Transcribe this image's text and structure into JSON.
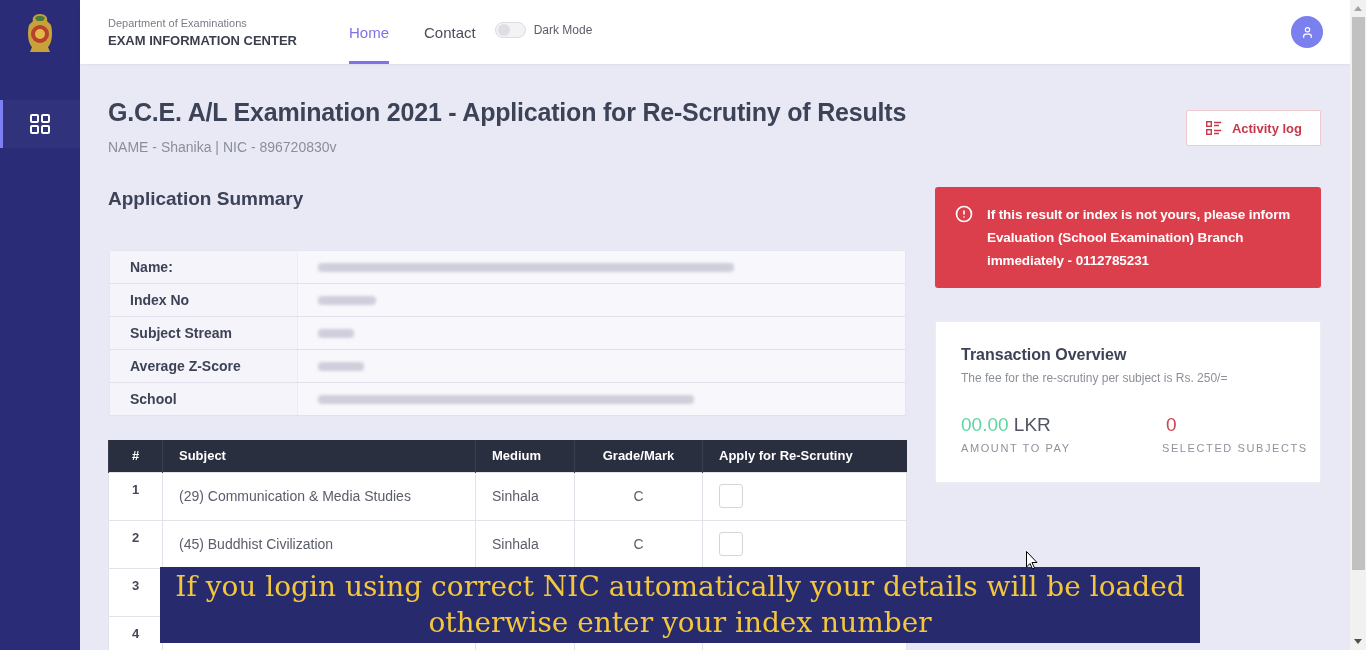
{
  "sidebar": {
    "items": [
      {
        "selected": true
      }
    ]
  },
  "header": {
    "org": "Department of Examinations",
    "title": "EXAM INFORMATION CENTER",
    "nav": [
      {
        "label": "Home",
        "selected": true
      },
      {
        "label": "Contact",
        "selected": false
      }
    ],
    "dark_mode": {
      "label": "Dark Mode",
      "on": false
    }
  },
  "page": {
    "title": "G.C.E. A/L Examination 2021 - Application for Re-Scrutiny of Results",
    "subtitle": "NAME - Shanika | NIC - 896720830v",
    "activity_button": "Activity log"
  },
  "summary": {
    "heading": "Application Summary",
    "rows": [
      {
        "label": "Name:",
        "blurred": true
      },
      {
        "label": "Index No",
        "blurred": true
      },
      {
        "label": "Subject Stream",
        "blurred": true
      },
      {
        "label": "Average Z-Score",
        "blurred": true
      },
      {
        "label": "School",
        "blurred": true
      }
    ]
  },
  "subjects": {
    "columns": [
      "#",
      "Subject",
      "Medium",
      "Grade/Mark",
      "Apply for Re-Scrutiny"
    ],
    "rows": [
      {
        "number": "1",
        "subject": "(29) Communication & Media Studies",
        "medium": "Sinhala",
        "grade": "C",
        "checked": false
      },
      {
        "number": "2",
        "subject": "(45) Buddhist Civilization",
        "medium": "Sinhala",
        "grade": "C",
        "checked": false
      },
      {
        "number": "3"
      },
      {
        "number": "4"
      }
    ]
  },
  "alert": {
    "text": "If this result or index is not yours, please inform Evaluation (School Examination) Branch immediately - 0112785231"
  },
  "transaction": {
    "title": "Transaction Overview",
    "note": "The fee for the re-scrutiny per subject is Rs. 250/=",
    "amount": "00.00",
    "currency": "LKR",
    "amount_label": "AMOUNT TO PAY",
    "count": "0",
    "count_label": "SELECTED SUBJECTS"
  },
  "caption": {
    "text": "If you login using correct NIC automatically your details will be loaded otherwise enter your index number"
  }
}
